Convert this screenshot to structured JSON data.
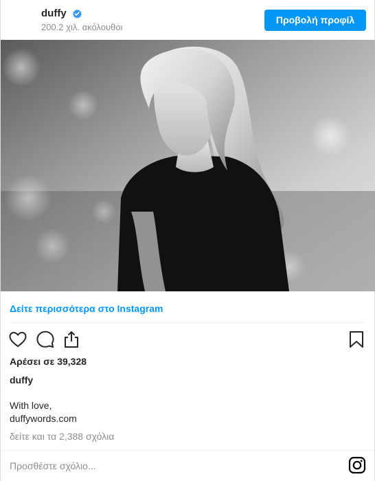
{
  "header": {
    "username": "duffy",
    "followers": "200.2 χιλ. ακόλουθοι",
    "profile_button": "Προβολή προφίλ"
  },
  "post": {
    "view_more": "Δείτε περισσότερα στο Instagram",
    "likes": "Αρέσει σε 39,328",
    "caption_user": "duffy",
    "caption_line1": "With love,",
    "caption_line2": "duffywords.com",
    "comments_link": "δείτε και τα 2,388 σχόλια",
    "add_comment_placeholder": "Προσθέστε σχόλιο..."
  },
  "colors": {
    "accent": "#0095f6",
    "text": "#262626",
    "muted": "#8e8e8e",
    "divider": "#efefef"
  },
  "icons": [
    "verified-badge-icon",
    "heart-icon",
    "comment-icon",
    "share-icon",
    "bookmark-icon",
    "instagram-glyph-icon"
  ]
}
